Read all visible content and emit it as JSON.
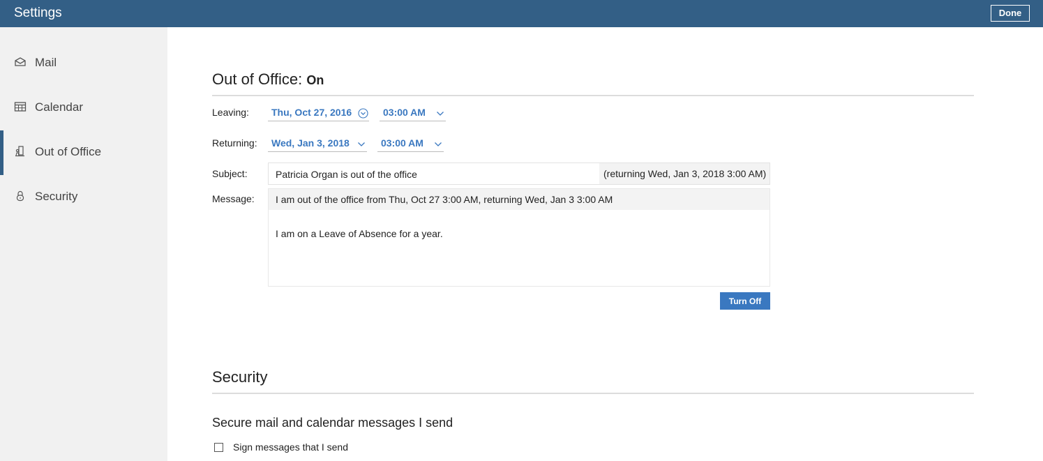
{
  "header": {
    "title": "Settings",
    "done_label": "Done"
  },
  "sidebar": {
    "items": [
      {
        "label": "Mail",
        "icon": "mail-icon"
      },
      {
        "label": "Calendar",
        "icon": "calendar-icon"
      },
      {
        "label": "Out of Office",
        "icon": "out-of-office-icon",
        "active": true
      },
      {
        "label": "Security",
        "icon": "lock-icon"
      }
    ]
  },
  "ooo": {
    "title": "Out of Office:",
    "status": "On",
    "leaving_label": "Leaving:",
    "leaving_date": "Thu, Oct 27, 2016",
    "leaving_time": "03:00 AM",
    "returning_label": "Returning:",
    "returning_date": "Wed, Jan 3, 2018",
    "returning_time": "03:00 AM",
    "subject_label": "Subject:",
    "subject_value": "Patricia Organ is out of the office",
    "subject_suffix": "(returning Wed, Jan 3, 2018 3:00 AM)",
    "message_label": "Message:",
    "message_auto": "I am out of the office from Thu, Oct 27 3:00 AM, returning Wed, Jan 3 3:00 AM",
    "message_body": "I am on a Leave of Absence for a year.",
    "turn_off_label": "Turn Off"
  },
  "security": {
    "title": "Security",
    "subtitle": "Secure mail and calendar messages I send",
    "sign_label": "Sign messages that I send",
    "sign_checked": false
  },
  "colors": {
    "header": "#335f86",
    "accent": "#3a78c0",
    "sidebar": "#f1f1f1"
  }
}
